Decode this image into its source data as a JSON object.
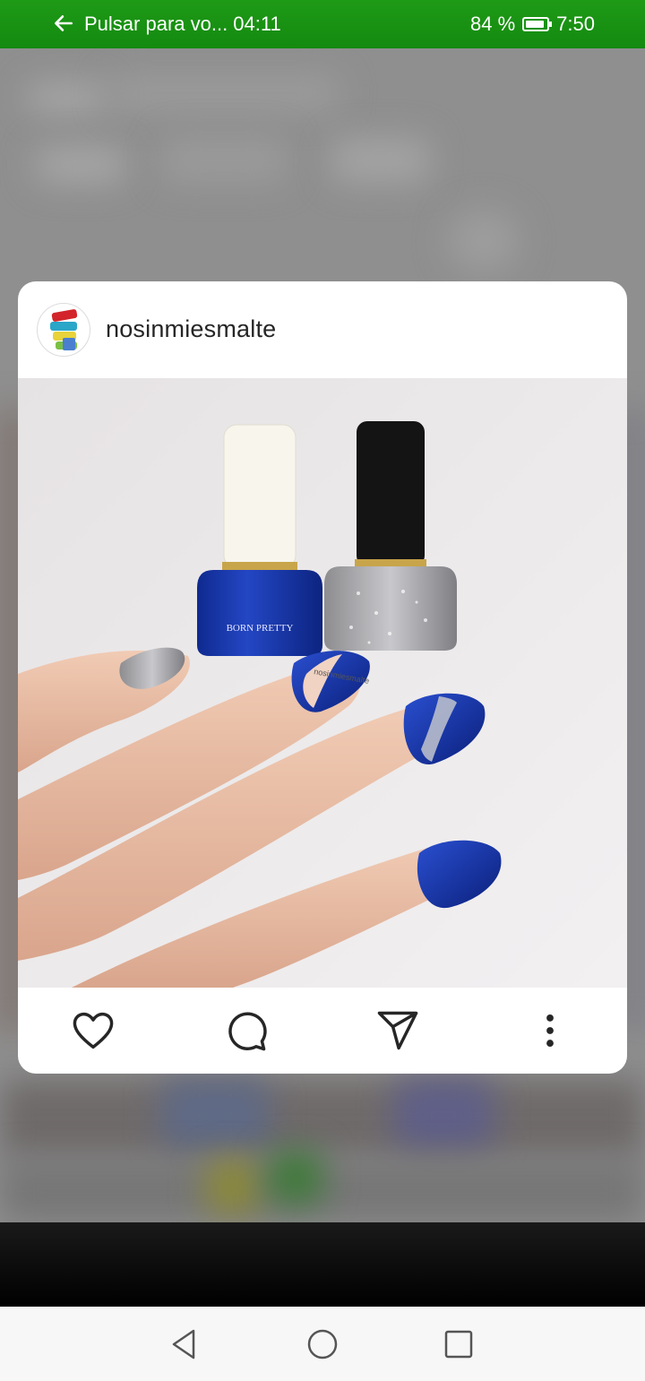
{
  "status_bar": {
    "back_text": "Pulsar para vo... 04:11",
    "battery": "84 %",
    "time": "7:50"
  },
  "post": {
    "username": "nosinmiesmalte",
    "image_watermark": "nosinmiesmalte",
    "bottle_label": "BORN PRETTY"
  },
  "actions": [
    "heart-icon",
    "comment-icon",
    "share-icon",
    "more-icon"
  ],
  "colors": {
    "status_bar": "#169112",
    "polish_blue": "#1533a8",
    "background_blur": "#8e8e8e"
  }
}
